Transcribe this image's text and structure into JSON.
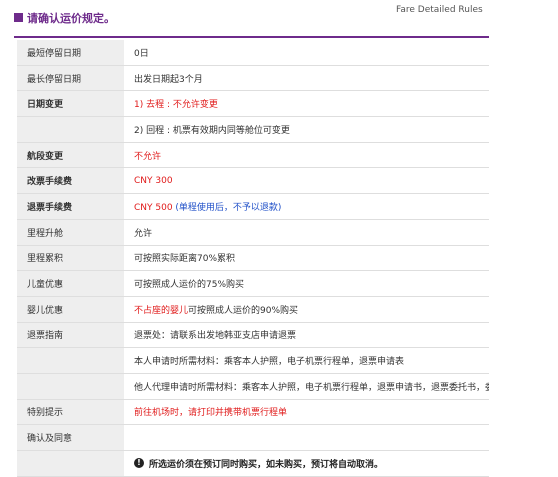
{
  "header": {
    "title": "请确认运价规定。",
    "subtitle_right": "Fare Detailed Rules",
    "accent_color": "#6e2b8b"
  },
  "rules": [
    {
      "label": "最短停留日期",
      "label_style": "normal",
      "parts": [
        {
          "text": "0日",
          "style": "normal"
        }
      ]
    },
    {
      "label": "最长停留日期",
      "label_style": "normal",
      "parts": [
        {
          "text": "出发日期起3个月",
          "style": "normal"
        }
      ]
    },
    {
      "label": "日期变更",
      "label_style": "red",
      "parts": [
        {
          "text": "1) 去程 : 不允许变更",
          "style": "red"
        }
      ]
    },
    {
      "label": "",
      "label_style": "normal",
      "parts": [
        {
          "text": "2) 回程 : 机票有效期内同等舱位可变更",
          "style": "normal"
        }
      ]
    },
    {
      "label": "航段变更",
      "label_style": "red",
      "parts": [
        {
          "text": "不允许",
          "style": "red"
        }
      ]
    },
    {
      "label": "改票手续费",
      "label_style": "red",
      "parts": [
        {
          "text": "CNY 300",
          "style": "red"
        }
      ]
    },
    {
      "label": "退票手续费",
      "label_style": "red",
      "parts": [
        {
          "text": "CNY 500 ",
          "style": "red"
        },
        {
          "text": "(单程使用后，不予以退款)",
          "style": "blue"
        }
      ]
    },
    {
      "label": "里程升舱",
      "label_style": "normal",
      "parts": [
        {
          "text": "允许",
          "style": "normal"
        }
      ]
    },
    {
      "label": "里程累积",
      "label_style": "normal",
      "parts": [
        {
          "text": "可按照实际距离70%累积",
          "style": "normal"
        }
      ]
    },
    {
      "label": "儿童优惠",
      "label_style": "normal",
      "parts": [
        {
          "text": "可按照成人运价的75%购买",
          "style": "normal"
        }
      ]
    },
    {
      "label": "婴儿优惠",
      "label_style": "normal",
      "parts": [
        {
          "text": "不占座的婴儿",
          "style": "red"
        },
        {
          "text": "可按照成人运价的90%购买",
          "style": "normal"
        }
      ]
    },
    {
      "label": "退票指南",
      "label_style": "normal",
      "parts": [
        {
          "text": "退票处：请联系出发地韩亚支店申请退票",
          "style": "normal"
        }
      ]
    },
    {
      "label": "",
      "label_style": "normal",
      "parts": [
        {
          "text": "本人申请时所需材料：乘客本人护照，电子机票行程单，退票申请表",
          "style": "normal"
        }
      ]
    },
    {
      "label": "",
      "label_style": "normal",
      "parts": [
        {
          "text": "他人代理申请时所需材料：乘客本人护照，电子机票行程单，退票申请书，退票委托书，委托人证件",
          "style": "normal"
        }
      ]
    },
    {
      "label": "特别提示",
      "label_style": "normal",
      "parts": [
        {
          "text": "前往机场时，请打印并携带机票行程单",
          "style": "red"
        }
      ]
    }
  ],
  "confirm": {
    "label": "确认及同意",
    "icon": "warning-icon",
    "icon_glyph": "!",
    "text": "所选运价须在预订同时购买，如未购买，预订将自动取消。"
  }
}
